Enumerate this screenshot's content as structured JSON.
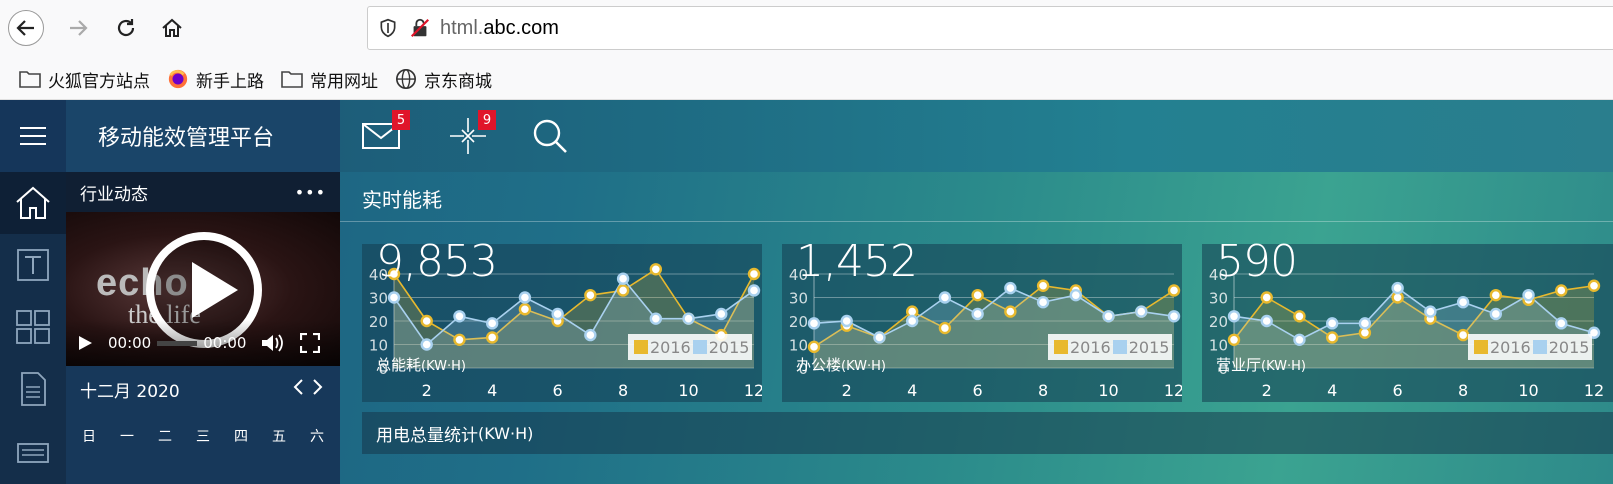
{
  "browser": {
    "url_dim": "html.",
    "url_main": "abc.com",
    "bookmarks": [
      {
        "label": "火狐官方站点",
        "icon": "folder-icon"
      },
      {
        "label": "新手上路",
        "icon": "firefox-icon"
      },
      {
        "label": "常用网址",
        "icon": "folder-icon"
      },
      {
        "label": "京东商城",
        "icon": "globe-icon"
      }
    ]
  },
  "app": {
    "brand": "移动能效管理平台",
    "mail_badge": "5",
    "alert_badge": "9",
    "panel_title": "行业动态",
    "panel_more": "•••",
    "video": {
      "word1": "echo",
      "word2": "the life",
      "time_current": "00:00",
      "time_total": "00:00"
    },
    "calendar": {
      "month": "十二月 2020",
      "weekdays": [
        "日",
        "一",
        "二",
        "三",
        "四",
        "五",
        "六"
      ]
    },
    "section_title": "实时能耗",
    "bottom_title": "用电总量统计",
    "bottom_unit": "(KW·H)"
  },
  "chart_data": [
    {
      "type": "line",
      "big_number": "9,853",
      "label": "总能耗",
      "unit": "(KW·H)",
      "x": [
        1,
        2,
        3,
        4,
        5,
        6,
        7,
        8,
        9,
        10,
        11,
        12
      ],
      "x_ticks": [
        2,
        4,
        6,
        8,
        10,
        12
      ],
      "y_ticks": [
        0,
        10,
        20,
        30,
        40
      ],
      "ylim": [
        0,
        40
      ],
      "series": [
        {
          "name": "2016",
          "color": "#e8b92e",
          "values": [
            40,
            20,
            12,
            13,
            25,
            20,
            31,
            33,
            42,
            21,
            14,
            40
          ]
        },
        {
          "name": "2015",
          "color": "#a9d1ef",
          "values": [
            30,
            10,
            22,
            19,
            30,
            23,
            14,
            38,
            21,
            21,
            23,
            33
          ]
        }
      ]
    },
    {
      "type": "line",
      "big_number": "1,452",
      "label": "办公楼",
      "unit": "(KW·H)",
      "x": [
        1,
        2,
        3,
        4,
        5,
        6,
        7,
        8,
        9,
        10,
        11,
        12
      ],
      "x_ticks": [
        2,
        4,
        6,
        8,
        10,
        12
      ],
      "y_ticks": [
        0,
        10,
        20,
        30,
        40
      ],
      "ylim": [
        0,
        40
      ],
      "series": [
        {
          "name": "2016",
          "color": "#e8b92e",
          "values": [
            9,
            18,
            13,
            24,
            17,
            31,
            24,
            35,
            33,
            22,
            24,
            33
          ]
        },
        {
          "name": "2015",
          "color": "#a9d1ef",
          "values": [
            19,
            20,
            13,
            20,
            30,
            23,
            34,
            28,
            31,
            22,
            24,
            22
          ]
        }
      ]
    },
    {
      "type": "line",
      "big_number": "590",
      "label": "营业厅",
      "unit": "(KW·H)",
      "x": [
        1,
        2,
        3,
        4,
        5,
        6,
        7,
        8,
        9,
        10,
        11,
        12
      ],
      "x_ticks": [
        2,
        4,
        6,
        8,
        10,
        12
      ],
      "y_ticks": [
        0,
        10,
        20,
        30,
        40
      ],
      "ylim": [
        0,
        40
      ],
      "series": [
        {
          "name": "2016",
          "color": "#e8b92e",
          "values": [
            12,
            30,
            22,
            13,
            15,
            30,
            21,
            14,
            31,
            29,
            33,
            35
          ]
        },
        {
          "name": "2015",
          "color": "#a9d1ef",
          "values": [
            22,
            20,
            12,
            19,
            19,
            34,
            24,
            28,
            23,
            31,
            19,
            15
          ]
        }
      ]
    }
  ]
}
